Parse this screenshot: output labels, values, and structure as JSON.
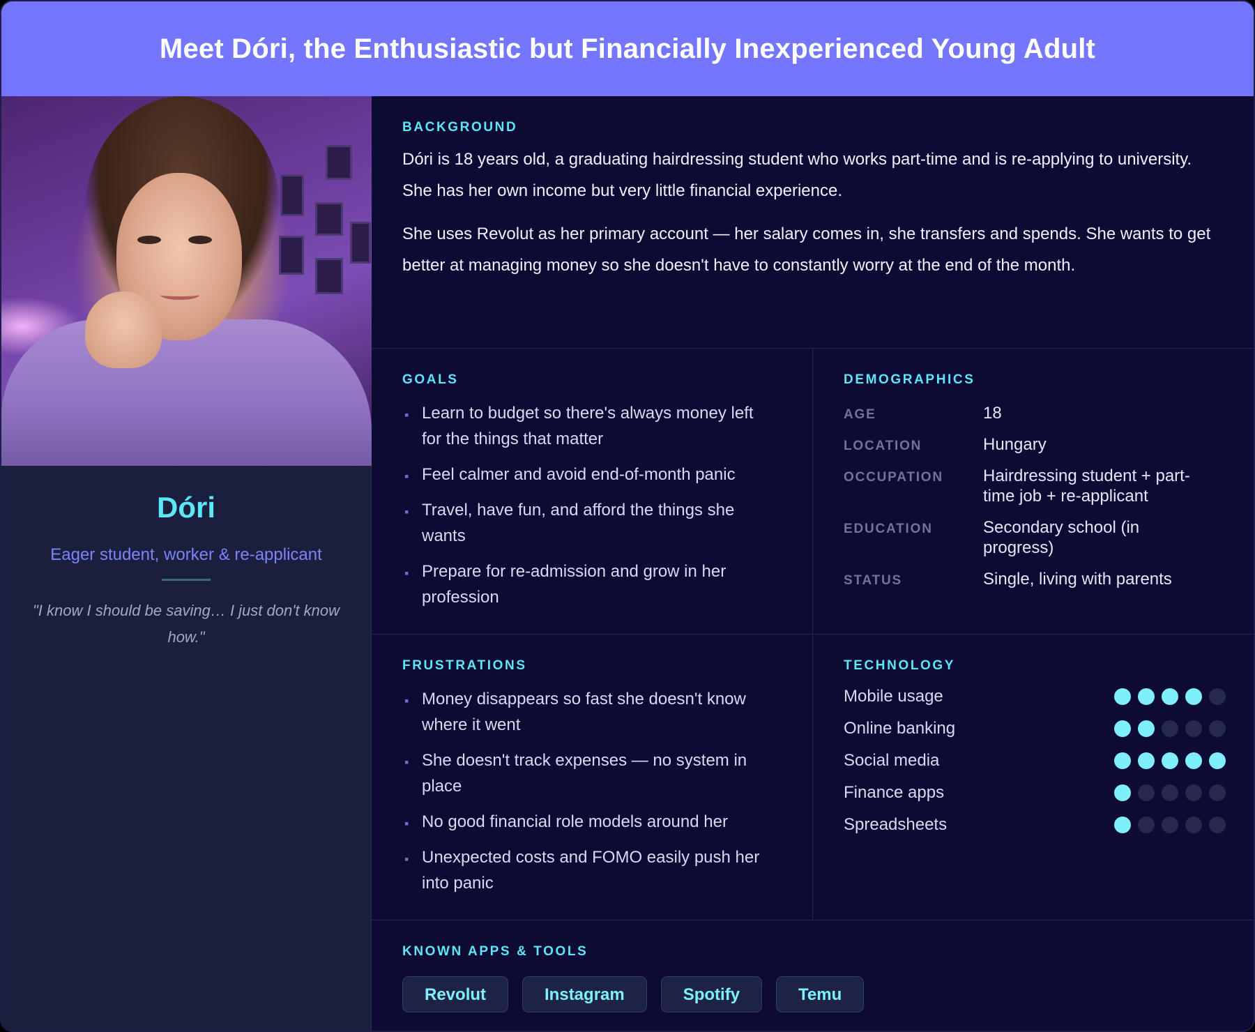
{
  "header": {
    "title": "Meet Dóri, the Enthusiastic but Financially Inexperienced Young Adult"
  },
  "profile": {
    "name": "Dóri",
    "role": "Eager student, worker & re-applicant",
    "quote": "\"I know I should be saving… I just don't know how.\""
  },
  "background": {
    "label": "BACKGROUND",
    "paragraphs": [
      "Dóri is 18 years old, a graduating hairdressing student who works part-time and is re-applying to university. She has her own income but very little financial experience.",
      "She uses Revolut as her primary account — her salary comes in, she transfers and spends. She wants to get better at managing money so she doesn't have to constantly worry at the end of the month."
    ]
  },
  "goals": {
    "label": "GOALS",
    "items": [
      "Learn to budget so there's always money left for the things that matter",
      "Feel calmer and avoid end-of-month panic",
      "Travel, have fun, and afford the things she wants",
      "Prepare for re-admission and grow in her profession"
    ]
  },
  "demographics": {
    "label": "DEMOGRAPHICS",
    "rows": [
      {
        "key": "AGE",
        "value": "18"
      },
      {
        "key": "LOCATION",
        "value": "Hungary"
      },
      {
        "key": "OCCUPATION",
        "value": "Hairdressing student + part-time job + re-applicant"
      },
      {
        "key": "EDUCATION",
        "value": "Secondary school (in progress)"
      },
      {
        "key": "STATUS",
        "value": "Single, living with parents"
      }
    ]
  },
  "frustrations": {
    "label": "FRUSTRATIONS",
    "items": [
      "Money disappears so fast she doesn't know where it went",
      "She doesn't track expenses — no system in place",
      "No good financial role models around her",
      "Unexpected costs and FOMO easily push her into panic"
    ]
  },
  "technology": {
    "label": "TECHNOLOGY",
    "max": 5,
    "rows": [
      {
        "label": "Mobile usage",
        "level": 4
      },
      {
        "label": "Online banking",
        "level": 2
      },
      {
        "label": "Social media",
        "level": 5
      },
      {
        "label": "Finance apps",
        "level": 1
      },
      {
        "label": "Spreadsheets",
        "level": 1
      }
    ]
  },
  "tools": {
    "label": "KNOWN APPS & TOOLS",
    "items": [
      "Revolut",
      "Instagram",
      "Spotify",
      "Temu"
    ]
  },
  "colors": {
    "header": "#7476fb",
    "accent": "#5de6f5",
    "background": "#0d0a33",
    "sidebar": "#1a1f3d"
  }
}
